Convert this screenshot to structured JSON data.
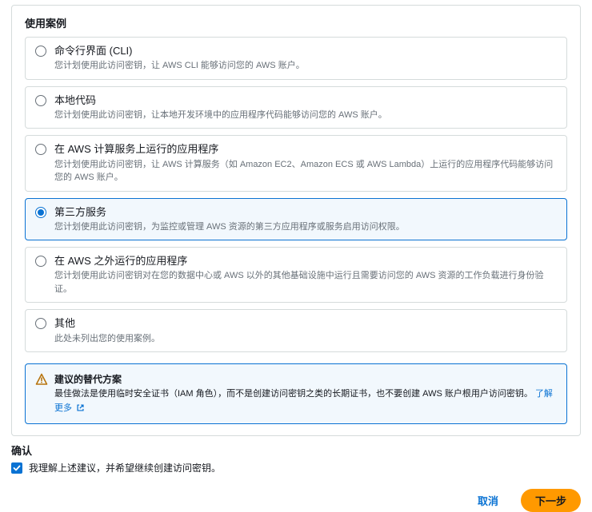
{
  "section_title": "使用案例",
  "options": [
    {
      "label": "命令行界面 (CLI)",
      "desc": "您计划使用此访问密钥，让 AWS CLI 能够访问您的 AWS 账户。"
    },
    {
      "label": "本地代码",
      "desc": "您计划使用此访问密钥，让本地开发环境中的应用程序代码能够访问您的 AWS 账户。"
    },
    {
      "label": "在 AWS 计算服务上运行的应用程序",
      "desc": "您计划使用此访问密钥，让 AWS 计算服务（如 Amazon EC2、Amazon ECS 或 AWS Lambda）上运行的应用程序代码能够访问您的 AWS 账户。"
    },
    {
      "label": "第三方服务",
      "desc": "您计划使用此访问密钥，为监控或管理 AWS 资源的第三方应用程序或服务启用访问权限。"
    },
    {
      "label": "在 AWS 之外运行的应用程序",
      "desc": "您计划使用此访问密钥对在您的数据中心或 AWS 以外的其他基础设施中运行且需要访问您的 AWS 资源的工作负载进行身份验证。"
    },
    {
      "label": "其他",
      "desc": "此处未列出您的使用案例。"
    }
  ],
  "selected_index": 3,
  "alert": {
    "title": "建议的替代方案",
    "text_prefix": "最佳做法是使用临时安全证书（IAM 角色），而不是创建访问密钥之类的长期证书，也不要创建 AWS 账户根用户访问密钥。",
    "link_label": "了解更多"
  },
  "confirm": {
    "title": "确认",
    "label": "我理解上述建议，并希望继续创建访问密钥。",
    "checked": true
  },
  "footer": {
    "cancel": "取消",
    "next": "下一步"
  }
}
